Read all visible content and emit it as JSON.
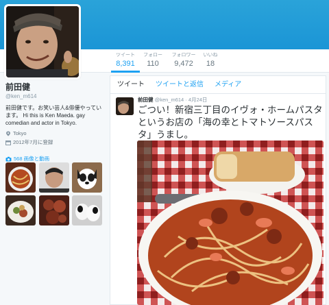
{
  "profile": {
    "name": "前田健",
    "handle": "@ken_m614",
    "bio": "前田健です。お笑い芸人&俳優やっています。 Hi this is Ken Maeda. gay comedian and actor in Tokyo.",
    "location": "Tokyo",
    "joined": "2012年7月に登録",
    "media_link": "568 画像と動画"
  },
  "stats": [
    {
      "label": "ツイート",
      "value": "8,391"
    },
    {
      "label": "フォロー",
      "value": "110"
    },
    {
      "label": "フォロワー",
      "value": "9,472"
    },
    {
      "label": "いいね",
      "value": "18"
    }
  ],
  "tabs": [
    "ツイート",
    "ツイートと返信",
    "メディア"
  ],
  "tweet": {
    "author": "前田健",
    "handle": "@ken_m614",
    "date": "4月24日",
    "text": "ごつい！新宿三丁目のイヴォ・ホームパスタというお店の「海の幸とトマトソースパスタ」うまし。"
  },
  "colors": {
    "accent": "#1da1f2",
    "banner": "#2aa3d9"
  },
  "icons": [
    "location-icon",
    "calendar-icon",
    "camera-icon"
  ]
}
